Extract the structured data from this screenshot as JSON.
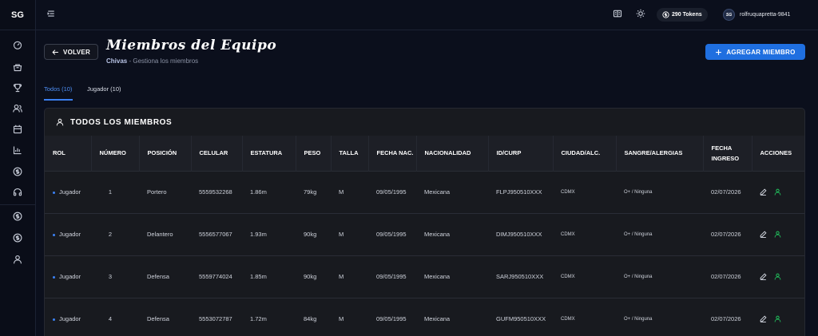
{
  "sidebar": {
    "logo": "SG"
  },
  "topbar": {
    "tokens": "290 Tokens",
    "username": "rolfruquapretta-9841",
    "avatar_text": "SG"
  },
  "header": {
    "back_label": "VOLVER",
    "title": "Miembros del Equipo",
    "team": "Chivas",
    "subtitle": " - Gestiona los miembros",
    "add_label": "AGREGAR MIEMBRO"
  },
  "tabs": [
    {
      "label": "Todos (10)",
      "active": true
    },
    {
      "label": "Jugador (10)",
      "active": false
    }
  ],
  "card": {
    "title": "TODOS LOS MIEMBROS",
    "headers": [
      "ROL",
      "NÚMERO",
      "POSICIÓN",
      "CELULAR",
      "ESTATURA",
      "PESO",
      "TALLA",
      "FECHA NAC.",
      "NACIONALIDAD",
      "ID/CURP",
      "CIUDAD/ALC.",
      "SANGRE/ALERGIAS",
      "FECHA INGRESO",
      "ACCIONES"
    ],
    "rows": [
      {
        "rol": "Jugador",
        "numero": "1",
        "posicion": "Portero",
        "celular": "5559532268",
        "estatura": "1.86m",
        "peso": "79kg",
        "talla": "M",
        "fecha_nac": "09/05/1995",
        "nacionalidad": "Mexicana",
        "curp": "FLPJ950510XXX",
        "ciudad": "CDMX",
        "sangre": "O+ / Ninguna",
        "ingreso": "02/07/2026"
      },
      {
        "rol": "Jugador",
        "numero": "2",
        "posicion": "Delantero",
        "celular": "5556577067",
        "estatura": "1.93m",
        "peso": "90kg",
        "talla": "M",
        "fecha_nac": "09/05/1995",
        "nacionalidad": "Mexicana",
        "curp": "DIMJ950510XXX",
        "ciudad": "CDMX",
        "sangre": "O+ / Ninguna",
        "ingreso": "02/07/2026"
      },
      {
        "rol": "Jugador",
        "numero": "3",
        "posicion": "Defensa",
        "celular": "5559774024",
        "estatura": "1.85m",
        "peso": "90kg",
        "talla": "M",
        "fecha_nac": "09/05/1995",
        "nacionalidad": "Mexicana",
        "curp": "SARJ950510XXX",
        "ciudad": "CDMX",
        "sangre": "O+ / Ninguna",
        "ingreso": "02/07/2026"
      },
      {
        "rol": "Jugador",
        "numero": "4",
        "posicion": "Defensa",
        "celular": "5553072787",
        "estatura": "1.72m",
        "peso": "84kg",
        "talla": "M",
        "fecha_nac": "09/05/1995",
        "nacionalidad": "Mexicana",
        "curp": "GUFM950510XXX",
        "ciudad": "CDMX",
        "sangre": "O+ / Ninguna",
        "ingreso": "02/07/2026"
      }
    ]
  },
  "colors": {
    "accent": "#1f6fe0",
    "rol_dot": "#3b82f6",
    "assign_icon": "#22c55e"
  },
  "icons": {
    "sidebar": [
      "dashboard-icon",
      "store-icon",
      "trophy-icon",
      "users-icon",
      "calendar-icon",
      "chart-icon",
      "dollar-icon",
      "headset-icon",
      "dollar-icon",
      "dollar-icon",
      "user-icon"
    ],
    "topbar": [
      "menu-icon",
      "book-icon",
      "sun-icon",
      "coin-icon"
    ],
    "row_actions": [
      "edit-icon",
      "user-assign-icon"
    ]
  }
}
